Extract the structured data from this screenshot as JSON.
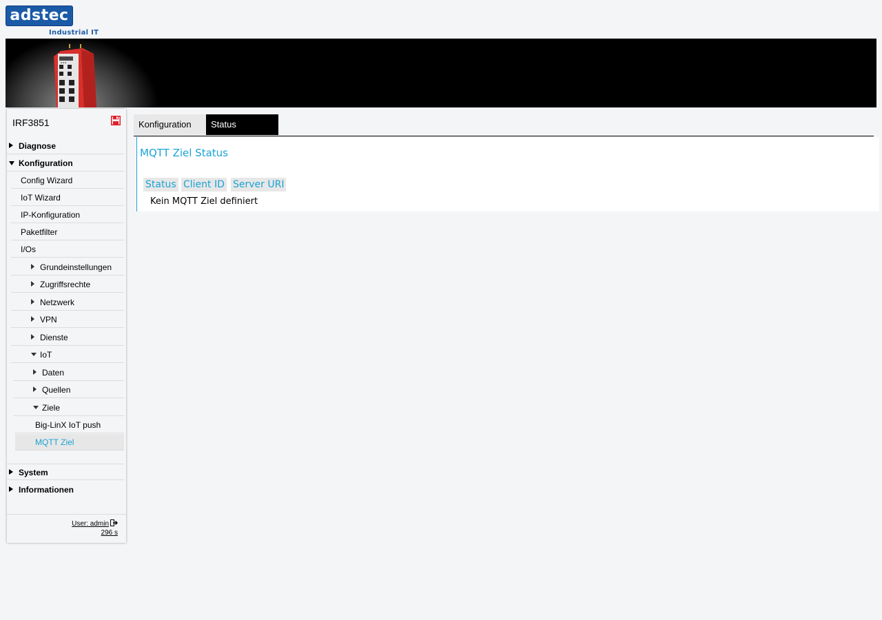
{
  "logo": {
    "brand": "adstec",
    "tagline": "Industrial IT"
  },
  "device": {
    "name": "IRF3851"
  },
  "sidebar": {
    "items": [
      {
        "label": "Diagnose"
      },
      {
        "label": "Konfiguration"
      },
      {
        "label": "Config Wizard"
      },
      {
        "label": "IoT Wizard"
      },
      {
        "label": "IP-Konfiguration"
      },
      {
        "label": "Paketfilter"
      },
      {
        "label": "I/Os"
      },
      {
        "label": "Grundeinstellungen"
      },
      {
        "label": "Zugriffsrechte"
      },
      {
        "label": "Netzwerk"
      },
      {
        "label": "VPN"
      },
      {
        "label": "Dienste"
      },
      {
        "label": "IoT"
      },
      {
        "label": "Daten"
      },
      {
        "label": "Quellen"
      },
      {
        "label": "Ziele"
      },
      {
        "label": "Big-LinX IoT push"
      },
      {
        "label": "MQTT Ziel"
      },
      {
        "label": "System"
      },
      {
        "label": "Informationen"
      }
    ],
    "active_item": "MQTT Ziel"
  },
  "user": {
    "label": "User: admin",
    "session": "296 s"
  },
  "tabs": [
    {
      "label": "Konfiguration",
      "active": false
    },
    {
      "label": "Status",
      "active": true
    }
  ],
  "main": {
    "title": "MQTT Ziel Status",
    "columns": [
      "Status",
      "Client ID",
      "Server URI"
    ],
    "empty_message": "Kein MQTT Ziel definiert"
  },
  "colors": {
    "accent": "#1aa3d4",
    "brand": "#1a5aa6",
    "banner": "#000000",
    "device": "#d8302c"
  }
}
